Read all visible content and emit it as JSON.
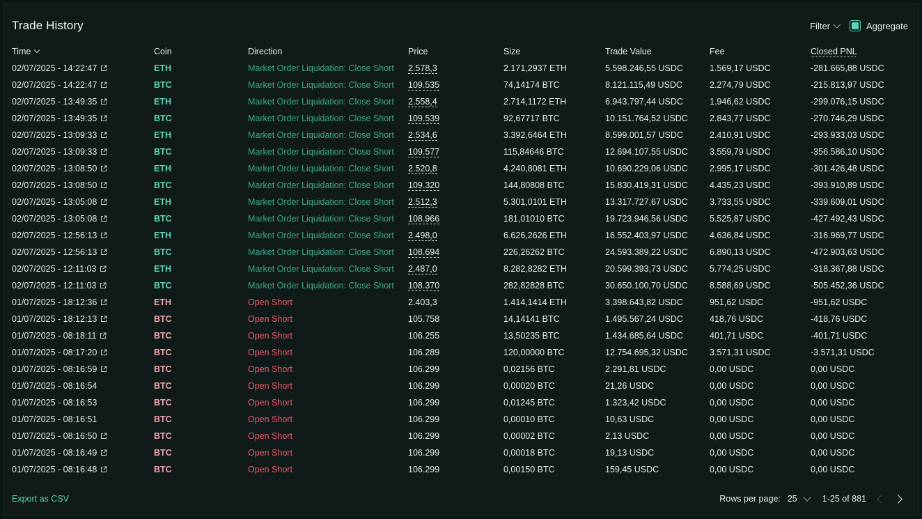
{
  "header": {
    "title": "Trade History",
    "filter_label": "Filter",
    "aggregate_label": "Aggregate",
    "aggregate_checked": true
  },
  "columns": {
    "time": "Time",
    "coin": "Coin",
    "direction": "Direction",
    "price": "Price",
    "size": "Size",
    "trade_value": "Trade Value",
    "fee": "Fee",
    "closed_pnl": "Closed PNL"
  },
  "colors": {
    "accent": "#5ed4b9",
    "close_direction": "#3fa88d",
    "open_direction": "#ed5a6a",
    "coin_eth": "#5ed4b9",
    "coin_btc_short": "#f0a3ad"
  },
  "rows": [
    {
      "time": "02/07/2025 - 14:22:47",
      "link": true,
      "coin": "ETH",
      "coin_style": "long",
      "direction": "Market Order Liquidation: Close Short",
      "dir_style": "close",
      "price": "2.578,3",
      "price_ul": true,
      "size": "2.171,2937 ETH",
      "value": "5.598.246,55 USDC",
      "fee": "1.569,17 USDC",
      "pnl": "-281.665,88 USDC"
    },
    {
      "time": "02/07/2025 - 14:22:47",
      "link": true,
      "coin": "BTC",
      "coin_style": "long",
      "direction": "Market Order Liquidation: Close Short",
      "dir_style": "close",
      "price": "109.535",
      "price_ul": true,
      "size": "74,14174 BTC",
      "value": "8.121.115,49 USDC",
      "fee": "2.274,79 USDC",
      "pnl": "-215.813,97 USDC"
    },
    {
      "time": "02/07/2025 - 13:49:35",
      "link": true,
      "coin": "ETH",
      "coin_style": "long",
      "direction": "Market Order Liquidation: Close Short",
      "dir_style": "close",
      "price": "2.558,4",
      "price_ul": true,
      "size": "2.714,1172 ETH",
      "value": "6.943.797,44 USDC",
      "fee": "1.946,62 USDC",
      "pnl": "-299.076,15 USDC"
    },
    {
      "time": "02/07/2025 - 13:49:35",
      "link": true,
      "coin": "BTC",
      "coin_style": "long",
      "direction": "Market Order Liquidation: Close Short",
      "dir_style": "close",
      "price": "109.539",
      "price_ul": true,
      "size": "92,67717 BTC",
      "value": "10.151.764,52 USDC",
      "fee": "2.843,77 USDC",
      "pnl": "-270.746,29 USDC"
    },
    {
      "time": "02/07/2025 - 13:09:33",
      "link": true,
      "coin": "ETH",
      "coin_style": "long",
      "direction": "Market Order Liquidation: Close Short",
      "dir_style": "close",
      "price": "2.534,6",
      "price_ul": true,
      "size": "3.392,6464 ETH",
      "value": "8.599.001,57 USDC",
      "fee": "2.410,91 USDC",
      "pnl": "-293.933,03 USDC"
    },
    {
      "time": "02/07/2025 - 13:09:33",
      "link": true,
      "coin": "BTC",
      "coin_style": "long",
      "direction": "Market Order Liquidation: Close Short",
      "dir_style": "close",
      "price": "109.577",
      "price_ul": true,
      "size": "115,84646 BTC",
      "value": "12.694.107,55 USDC",
      "fee": "3.559,79 USDC",
      "pnl": "-356.586,10 USDC"
    },
    {
      "time": "02/07/2025 - 13:08:50",
      "link": true,
      "coin": "ETH",
      "coin_style": "long",
      "direction": "Market Order Liquidation: Close Short",
      "dir_style": "close",
      "price": "2.520,8",
      "price_ul": true,
      "size": "4.240,8081 ETH",
      "value": "10.690.229,06 USDC",
      "fee": "2.995,17 USDC",
      "pnl": "-301.426,48 USDC"
    },
    {
      "time": "02/07/2025 - 13:08:50",
      "link": true,
      "coin": "BTC",
      "coin_style": "long",
      "direction": "Market Order Liquidation: Close Short",
      "dir_style": "close",
      "price": "109.320",
      "price_ul": true,
      "size": "144,80808 BTC",
      "value": "15.830.419,31 USDC",
      "fee": "4.435,23 USDC",
      "pnl": "-393.910,89 USDC"
    },
    {
      "time": "02/07/2025 - 13:05:08",
      "link": true,
      "coin": "ETH",
      "coin_style": "long",
      "direction": "Market Order Liquidation: Close Short",
      "dir_style": "close",
      "price": "2.512,3",
      "price_ul": true,
      "size": "5.301,0101 ETH",
      "value": "13.317.727,67 USDC",
      "fee": "3.733,55 USDC",
      "pnl": "-339.609,01 USDC"
    },
    {
      "time": "02/07/2025 - 13:05:08",
      "link": true,
      "coin": "BTC",
      "coin_style": "long",
      "direction": "Market Order Liquidation: Close Short",
      "dir_style": "close",
      "price": "108.966",
      "price_ul": true,
      "size": "181,01010 BTC",
      "value": "19.723.946,56 USDC",
      "fee": "5.525,87 USDC",
      "pnl": "-427.492,43 USDC"
    },
    {
      "time": "02/07/2025 - 12:56:13",
      "link": true,
      "coin": "ETH",
      "coin_style": "long",
      "direction": "Market Order Liquidation: Close Short",
      "dir_style": "close",
      "price": "2.498,0",
      "price_ul": true,
      "size": "6.626,2626 ETH",
      "value": "16.552.403,97 USDC",
      "fee": "4.636,84 USDC",
      "pnl": "-316.969,77 USDC"
    },
    {
      "time": "02/07/2025 - 12:56:13",
      "link": true,
      "coin": "BTC",
      "coin_style": "long",
      "direction": "Market Order Liquidation: Close Short",
      "dir_style": "close",
      "price": "108.694",
      "price_ul": true,
      "size": "226,26262 BTC",
      "value": "24.593.389,22 USDC",
      "fee": "6.890,13 USDC",
      "pnl": "-472.903,63 USDC"
    },
    {
      "time": "02/07/2025 - 12:11:03",
      "link": true,
      "coin": "ETH",
      "coin_style": "long",
      "direction": "Market Order Liquidation: Close Short",
      "dir_style": "close",
      "price": "2.487,0",
      "price_ul": true,
      "size": "8.282,8282 ETH",
      "value": "20.599.393,73 USDC",
      "fee": "5.774,25 USDC",
      "pnl": "-318.367,88 USDC"
    },
    {
      "time": "02/07/2025 - 12:11:03",
      "link": true,
      "coin": "BTC",
      "coin_style": "long",
      "direction": "Market Order Liquidation: Close Short",
      "dir_style": "close",
      "price": "108.370",
      "price_ul": true,
      "size": "282,82828 BTC",
      "value": "30.650.100,70 USDC",
      "fee": "8.588,69 USDC",
      "pnl": "-505.452,36 USDC"
    },
    {
      "time": "01/07/2025 - 18:12:36",
      "link": true,
      "coin": "ETH",
      "coin_style": "short",
      "direction": "Open Short",
      "dir_style": "open",
      "price": "2.403,3",
      "price_ul": false,
      "size": "1.414,1414 ETH",
      "value": "3.398.643,82 USDC",
      "fee": "951,62 USDC",
      "pnl": "-951,62 USDC"
    },
    {
      "time": "01/07/2025 - 18:12:13",
      "link": true,
      "coin": "BTC",
      "coin_style": "short",
      "direction": "Open Short",
      "dir_style": "open",
      "price": "105.758",
      "price_ul": false,
      "size": "14,14141 BTC",
      "value": "1.495.567,24 USDC",
      "fee": "418,76 USDC",
      "pnl": "-418,76 USDC"
    },
    {
      "time": "01/07/2025 - 08:18:11",
      "link": true,
      "coin": "BTC",
      "coin_style": "short",
      "direction": "Open Short",
      "dir_style": "open",
      "price": "106.255",
      "price_ul": false,
      "size": "13,50235 BTC",
      "value": "1.434.685,64 USDC",
      "fee": "401,71 USDC",
      "pnl": "-401,71 USDC"
    },
    {
      "time": "01/07/2025 - 08:17:20",
      "link": true,
      "coin": "BTC",
      "coin_style": "short",
      "direction": "Open Short",
      "dir_style": "open",
      "price": "106.289",
      "price_ul": false,
      "size": "120,00000 BTC",
      "value": "12.754.695,32 USDC",
      "fee": "3.571,31 USDC",
      "pnl": "-3.571,31 USDC"
    },
    {
      "time": "01/07/2025 - 08:16:59",
      "link": true,
      "coin": "BTC",
      "coin_style": "short",
      "direction": "Open Short",
      "dir_style": "open",
      "price": "106.299",
      "price_ul": false,
      "size": "0,02156 BTC",
      "value": "2.291,81 USDC",
      "fee": "0,00 USDC",
      "pnl": "0,00 USDC"
    },
    {
      "time": "01/07/2025 - 08:16:54",
      "link": false,
      "coin": "BTC",
      "coin_style": "short",
      "direction": "Open Short",
      "dir_style": "open",
      "price": "106.299",
      "price_ul": false,
      "size": "0,00020 BTC",
      "value": "21,26 USDC",
      "fee": "0,00 USDC",
      "pnl": "0,00 USDC"
    },
    {
      "time": "01/07/2025 - 08:16:53",
      "link": false,
      "coin": "BTC",
      "coin_style": "short",
      "direction": "Open Short",
      "dir_style": "open",
      "price": "106.299",
      "price_ul": false,
      "size": "0,01245 BTC",
      "value": "1.323,42 USDC",
      "fee": "0,00 USDC",
      "pnl": "0,00 USDC"
    },
    {
      "time": "01/07/2025 - 08:16:51",
      "link": false,
      "coin": "BTC",
      "coin_style": "short",
      "direction": "Open Short",
      "dir_style": "open",
      "price": "106.299",
      "price_ul": false,
      "size": "0,00010 BTC",
      "value": "10,63 USDC",
      "fee": "0,00 USDC",
      "pnl": "0,00 USDC"
    },
    {
      "time": "01/07/2025 - 08:16:50",
      "link": true,
      "coin": "BTC",
      "coin_style": "short",
      "direction": "Open Short",
      "dir_style": "open",
      "price": "106.299",
      "price_ul": false,
      "size": "0,00002 BTC",
      "value": "2,13 USDC",
      "fee": "0,00 USDC",
      "pnl": "0,00 USDC"
    },
    {
      "time": "01/07/2025 - 08:16:49",
      "link": true,
      "coin": "BTC",
      "coin_style": "short",
      "direction": "Open Short",
      "dir_style": "open",
      "price": "106.299",
      "price_ul": false,
      "size": "0,00018 BTC",
      "value": "19,13 USDC",
      "fee": "0,00 USDC",
      "pnl": "0,00 USDC"
    },
    {
      "time": "01/07/2025 - 08:16:48",
      "link": true,
      "coin": "BTC",
      "coin_style": "short",
      "direction": "Open Short",
      "dir_style": "open",
      "price": "106.299",
      "price_ul": false,
      "size": "0,00150 BTC",
      "value": "159,45 USDC",
      "fee": "0,00 USDC",
      "pnl": "0,00 USDC"
    }
  ],
  "footer": {
    "export_label": "Export as CSV",
    "rows_per_page_label": "Rows per page:",
    "rows_per_page_value": "25",
    "range_label": "1-25 of 881"
  }
}
